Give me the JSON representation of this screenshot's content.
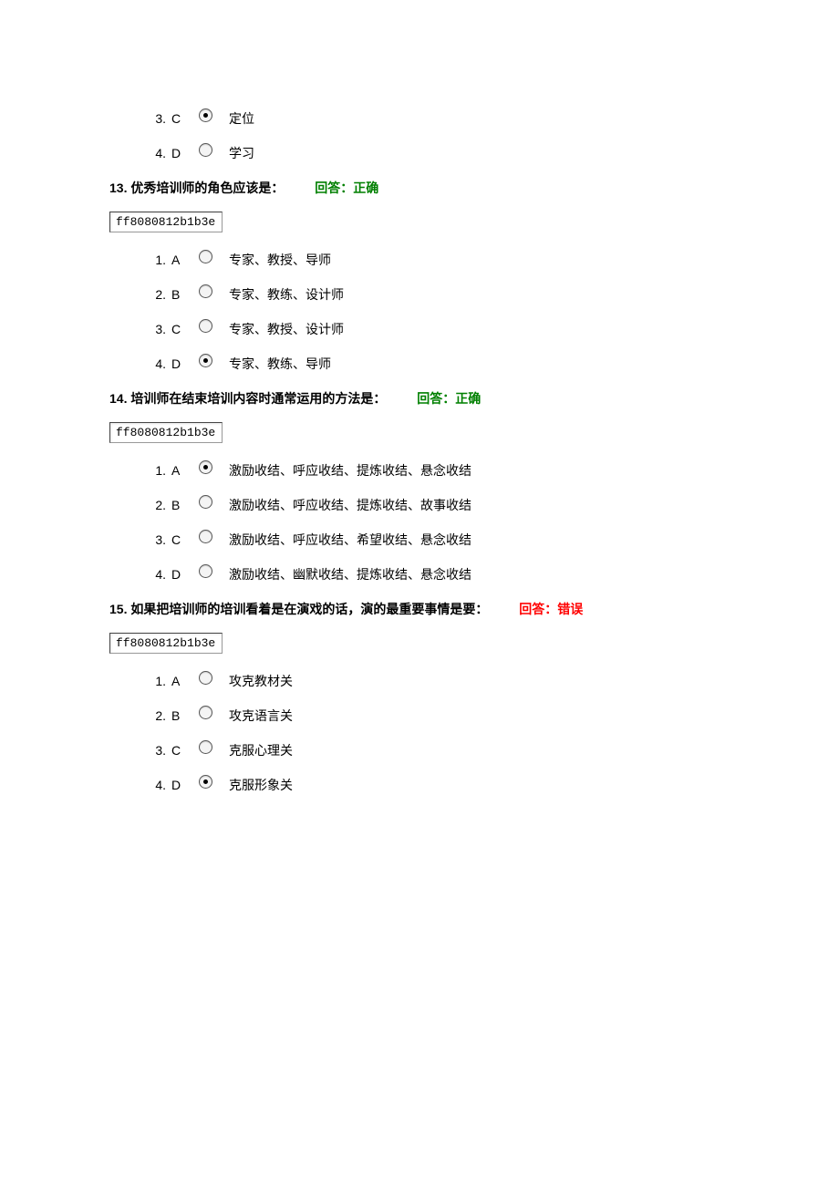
{
  "codeBoxText": "ff8080812b1b3e",
  "partialOptions": {
    "opt3": {
      "num": "3.",
      "letter": "C",
      "text": "定位",
      "selected": true
    },
    "opt4": {
      "num": "4.",
      "letter": "D",
      "text": "学习",
      "selected": false
    }
  },
  "questions": [
    {
      "number": "13.",
      "text": "优秀培训师的角色应该是：",
      "answerLabel": "回答：正确",
      "answerCorrect": true,
      "options": [
        {
          "num": "1.",
          "letter": "A",
          "text": "专家、教授、导师",
          "selected": false
        },
        {
          "num": "2.",
          "letter": "B",
          "text": "专家、教练、设计师",
          "selected": false
        },
        {
          "num": "3.",
          "letter": "C",
          "text": "专家、教授、设计师",
          "selected": false
        },
        {
          "num": "4.",
          "letter": "D",
          "text": "专家、教练、导师",
          "selected": true
        }
      ]
    },
    {
      "number": "14.",
      "text": "培训师在结束培训内容时通常运用的方法是：",
      "answerLabel": "回答：正确",
      "answerCorrect": true,
      "options": [
        {
          "num": "1.",
          "letter": "A",
          "text": "激励收结、呼应收结、提炼收结、悬念收结",
          "selected": true
        },
        {
          "num": "2.",
          "letter": "B",
          "text": "激励收结、呼应收结、提炼收结、故事收结",
          "selected": false
        },
        {
          "num": "3.",
          "letter": "C",
          "text": "激励收结、呼应收结、希望收结、悬念收结",
          "selected": false
        },
        {
          "num": "4.",
          "letter": "D",
          "text": "激励收结、幽默收结、提炼收结、悬念收结",
          "selected": false
        }
      ]
    },
    {
      "number": "15.",
      "text": "如果把培训师的培训看着是在演戏的话，演的最重要事情是要：",
      "answerLabel": "回答：错误",
      "answerCorrect": false,
      "options": [
        {
          "num": "1.",
          "letter": "A",
          "text": "攻克教材关",
          "selected": false
        },
        {
          "num": "2.",
          "letter": "B",
          "text": "攻克语言关",
          "selected": false
        },
        {
          "num": "3.",
          "letter": "C",
          "text": "克服心理关",
          "selected": false
        },
        {
          "num": "4.",
          "letter": "D",
          "text": "克服形象关",
          "selected": true
        }
      ]
    }
  ]
}
